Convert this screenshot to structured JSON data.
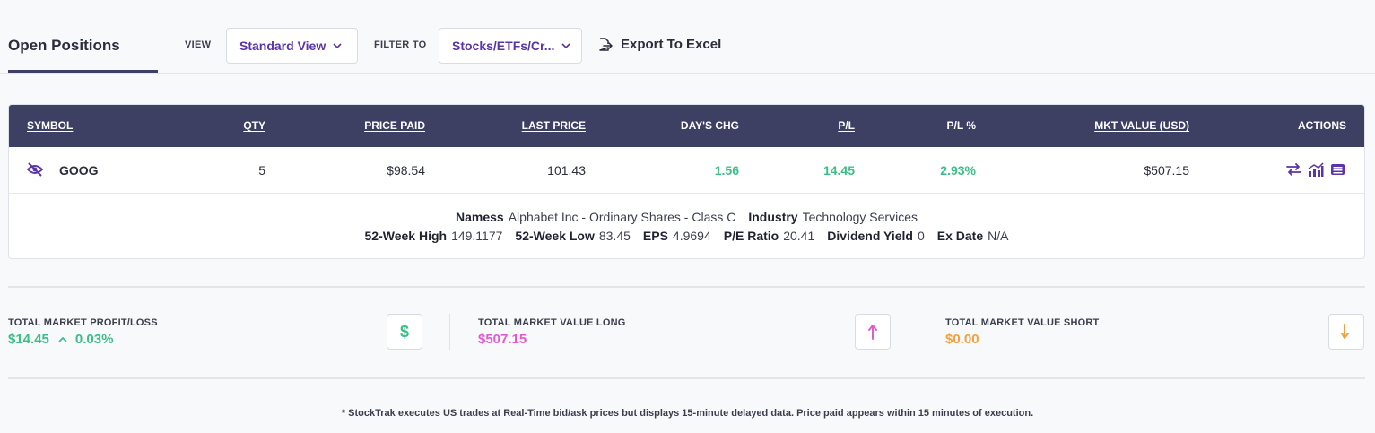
{
  "topbar": {
    "tab_title": "Open Positions",
    "view_label": "VIEW",
    "view_value": "Standard View",
    "filter_label": "FILTER TO",
    "filter_value": "Stocks/ETFs/Cr...",
    "export_label": "Export To Excel"
  },
  "table": {
    "headers": {
      "symbol": "SYMBOL",
      "qty": "QTY",
      "price_paid": "PRICE PAID",
      "last_price": "LAST PRICE",
      "days_chg": "DAY'S CHG",
      "pl": "P/L",
      "pl_pct": "P/L %",
      "mkt_value": "MKT VALUE (USD)",
      "actions": "ACTIONS"
    },
    "rows": [
      {
        "symbol": "GOOG",
        "qty": "5",
        "price_paid": "$98.54",
        "last_price": "101.43",
        "days_chg": "1.56",
        "pl": "14.45",
        "pl_pct": "2.93%",
        "mkt_value": "$507.15",
        "icons": [
          "eye-off-icon",
          "trade-icon",
          "chart-icon",
          "details-icon"
        ]
      }
    ],
    "details": {
      "name_label": "Namess",
      "name_value": "Alphabet Inc - Ordinary Shares - Class C",
      "industry_label": "Industry",
      "industry_value": "Technology Services",
      "high_label": "52-Week High",
      "high_value": "149.1177",
      "low_label": "52-Week Low",
      "low_value": "83.45",
      "eps_label": "EPS",
      "eps_value": "4.9694",
      "pe_label": "P/E Ratio",
      "pe_value": "20.41",
      "div_label": "Dividend Yield",
      "div_value": "0",
      "exdate_label": "Ex Date",
      "exdate_value": "N/A"
    }
  },
  "summary": {
    "pl_label": "TOTAL MARKET PROFIT/LOSS",
    "pl_value": "$14.45",
    "pl_pct": "0.03%",
    "pl_icon_glyph": "$",
    "long_label": "TOTAL MARKET VALUE LONG",
    "long_value": "$507.15",
    "short_label": "TOTAL MARKET VALUE SHORT",
    "short_value": "$0.00"
  },
  "colors": {
    "header_bg": "#3d3f63",
    "accent_purple": "#5a34a8",
    "green": "#3cbf86",
    "pink": "#e35ad0",
    "orange": "#f2a13c"
  },
  "footnote": "* StockTrak executes US trades at Real-Time bid/ask prices but displays 15-minute delayed data. Price paid appears within 15 minutes of execution."
}
